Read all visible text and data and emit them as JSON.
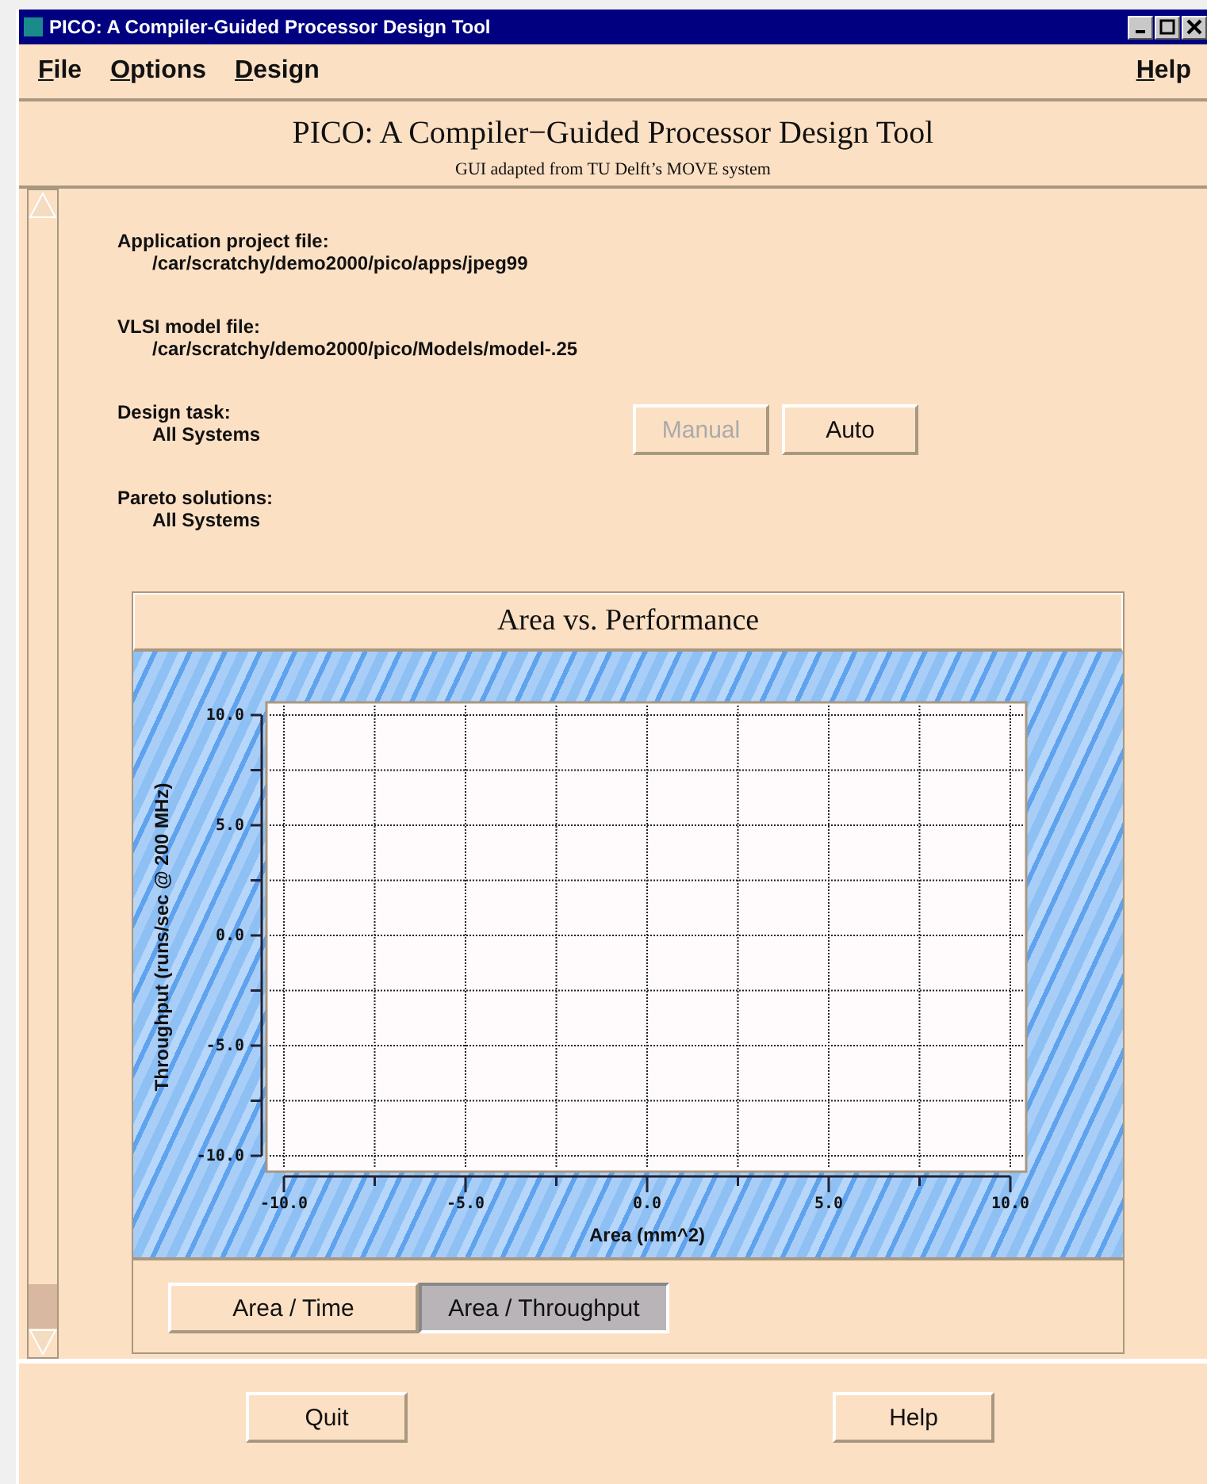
{
  "window": {
    "title": "PICO: A Compiler-Guided Processor Design Tool"
  },
  "menu": {
    "left": [
      "File",
      "Options",
      "Design"
    ],
    "right": [
      "Help"
    ]
  },
  "header": {
    "title": "PICO: A Compiler−Guided Processor Design Tool",
    "subtitle": "GUI adapted from TU Delft’s MOVE system"
  },
  "info": [
    {
      "label": "Application project file:",
      "value": "/car/scratchy/demo2000/pico/apps/jpeg99"
    },
    {
      "label": "VLSI model file:",
      "value": "/car/scratchy/demo2000/pico/Models/model-.25"
    },
    {
      "label": "Design task:",
      "value": "All Systems",
      "buttons": [
        {
          "label": "Manual",
          "disabled": true
        },
        {
          "label": "Auto",
          "disabled": false
        }
      ]
    },
    {
      "label": "Pareto solutions:",
      "value": "All Systems"
    }
  ],
  "chart_panel": {
    "chart_data": {
      "type": "scatter",
      "grid": true,
      "title": "Area vs. Performance",
      "xlabel": "Area (mm^2)",
      "ylabel": "Throughput (runs/sec @ 200 MHz)",
      "xlim": [
        -10,
        10
      ],
      "ylim": [
        -10,
        10
      ],
      "xticks": [
        {
          "value": -10,
          "label": "-10.0"
        },
        {
          "value": -5,
          "label": "-5.0"
        },
        {
          "value": 0,
          "label": "0.0"
        },
        {
          "value": 5,
          "label": "5.0"
        },
        {
          "value": 10,
          "label": "10.0"
        }
      ],
      "yticks": [
        {
          "value": -10,
          "label": "-10.0"
        },
        {
          "value": -5,
          "label": "-5.0"
        },
        {
          "value": 0,
          "label": "0.0"
        },
        {
          "value": 5,
          "label": "5.0"
        },
        {
          "value": 10,
          "label": "10.0"
        }
      ]
    },
    "tabs": [
      {
        "label": "Area / Time",
        "selected": false
      },
      {
        "label": "Area / Throughput",
        "selected": true
      }
    ]
  },
  "footer_buttons": [
    "Quit",
    "Help"
  ]
}
